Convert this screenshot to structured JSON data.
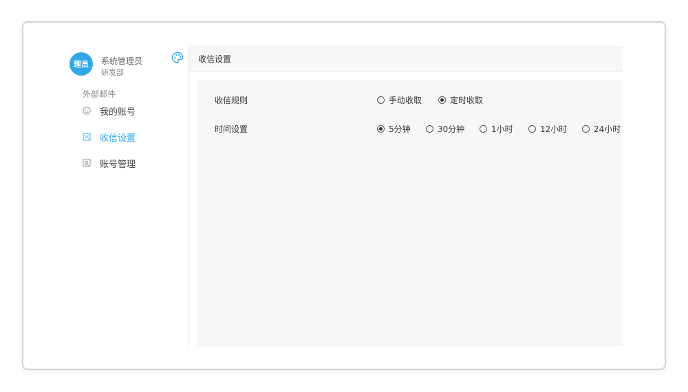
{
  "user": {
    "avatar_text": "理员",
    "name": "系统管理员",
    "department": "研发部"
  },
  "sidebar": {
    "section_label": "外部邮件",
    "items": [
      {
        "label": "我的账号",
        "icon": "user-circle-icon",
        "active": false
      },
      {
        "label": "收信设置",
        "icon": "mail-settings-icon",
        "active": true
      },
      {
        "label": "账号管理",
        "icon": "account-manage-icon",
        "active": false
      }
    ]
  },
  "main": {
    "title": "收信设置",
    "receive_rule": {
      "label": "收信规则",
      "options": [
        {
          "label": "手动收取",
          "checked": false
        },
        {
          "label": "定时收取",
          "checked": true
        }
      ]
    },
    "time_setting": {
      "label": "时间设置",
      "options": [
        {
          "label": "5分钟",
          "checked": true
        },
        {
          "label": "30分钟",
          "checked": false
        },
        {
          "label": "1小时",
          "checked": false
        },
        {
          "label": "12小时",
          "checked": false
        },
        {
          "label": "24小时",
          "checked": false
        }
      ]
    }
  },
  "colors": {
    "accent": "#2fa7e9",
    "panel_bg": "#f7f7f7",
    "border": "#d4d4d4"
  },
  "icons": {
    "theme": "palette-icon"
  }
}
